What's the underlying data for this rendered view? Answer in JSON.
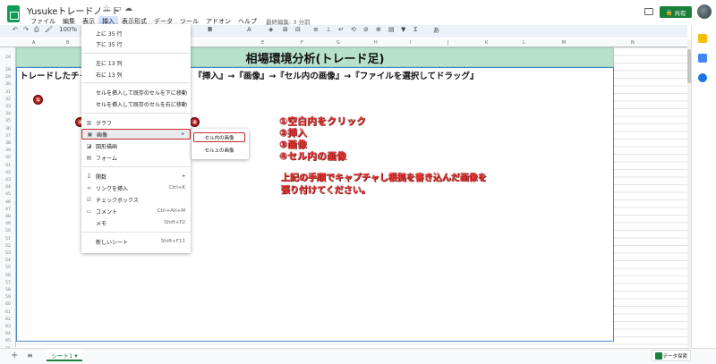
{
  "header": {
    "title": "Yusukeトレードノート",
    "menus": [
      "ファイル",
      "編集",
      "表示",
      "挿入",
      "表示形式",
      "データ",
      "ツール",
      "アドオン",
      "ヘルプ"
    ],
    "last_edit": "最終編集: 3 分前",
    "share_label": "共有"
  },
  "toolbar": {
    "zoom": "100%",
    "font_size_bold": "B"
  },
  "grid": {
    "col_labels": [
      "A",
      "B",
      "C",
      "D",
      "E",
      "F",
      "G",
      "H",
      "I",
      "J",
      "K",
      "L",
      "M",
      "N"
    ],
    "row_numbers": [
      "24",
      "28",
      "29",
      "30",
      "31",
      "32",
      "33",
      "34",
      "35",
      "36",
      "37",
      "38",
      "39",
      "40",
      "41",
      "42",
      "43",
      "44",
      "45",
      "46",
      "47",
      "48",
      "49",
      "50",
      "51",
      "52",
      "53",
      "54",
      "55",
      "56",
      "57",
      "58",
      "59",
      "60",
      "61",
      "62",
      "63",
      "64",
      "65",
      "66"
    ],
    "banner": "相場環境分析(トレード足)",
    "instruction": "トレードしたチャートを貼り付けてください　『挿入』→『画像』→『セル内の画像』→『ファイルを選択してドラッグ』"
  },
  "annotations": {
    "badges": [
      "①",
      "②",
      "③",
      "④"
    ],
    "steps": [
      "①空白内をクリック",
      "②挿入",
      "③画像",
      "④セル内の画像"
    ],
    "note": "上記の手順でキャプチャし根拠を書き込んだ画像を張り付けてください。"
  },
  "insert_menu": {
    "items": [
      {
        "label": "上に 35 行",
        "shortcut": ""
      },
      {
        "label": "下に 35 行",
        "shortcut": ""
      },
      {
        "label": "左に 13 列",
        "shortcut": ""
      },
      {
        "label": "右に 13 列",
        "shortcut": ""
      },
      {
        "label": "セルを挿入して既存のセルを下に移動",
        "shortcut": ""
      },
      {
        "label": "セルを挿入して既存のセルを右に移動",
        "shortcut": ""
      },
      {
        "label": "グラフ",
        "shortcut": ""
      },
      {
        "label": "画像",
        "shortcut": "▸"
      },
      {
        "label": "図形描画",
        "shortcut": ""
      },
      {
        "label": "フォーム",
        "shortcut": ""
      },
      {
        "label": "関数",
        "shortcut": "▸"
      },
      {
        "label": "リンクを挿入",
        "shortcut": "Ctrl+K"
      },
      {
        "label": "チェックボックス",
        "shortcut": ""
      },
      {
        "label": "コメント",
        "shortcut": "Ctrl+Alt+M"
      },
      {
        "label": "メモ",
        "shortcut": "Shift+F2"
      },
      {
        "label": "新しいシート",
        "shortcut": "Shift+F11"
      }
    ],
    "sub_items": [
      "セル内の画像",
      "セル上の画像"
    ]
  },
  "bottom": {
    "sheet_tab": "シート1 ▾",
    "explore": "データ探索"
  },
  "colors": {
    "accent_green": "#188038",
    "banner": "#b7e1cd",
    "annotation_red": "#e53935"
  }
}
